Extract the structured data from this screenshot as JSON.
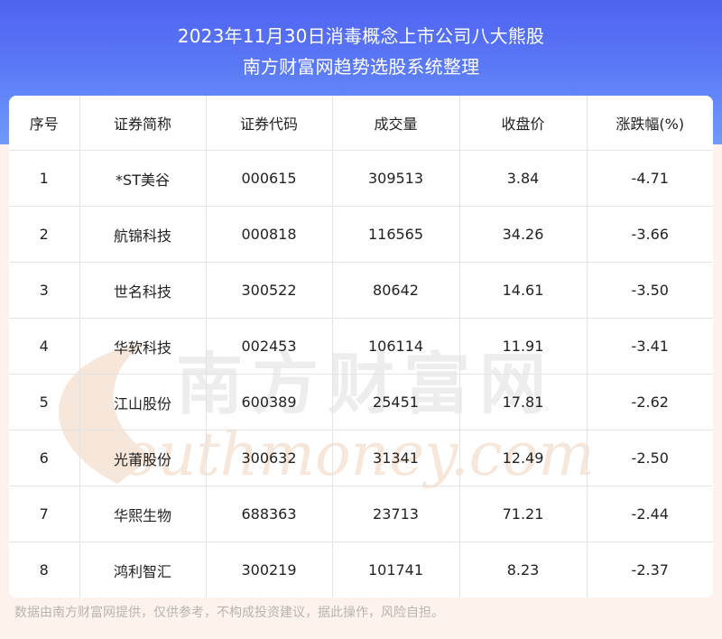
{
  "header": {
    "title_line1": "2023年11月30日消毒概念上市公司八大熊股",
    "title_line2": "南方财富网趋势选股系统整理"
  },
  "table": {
    "columns": [
      "序号",
      "证券简称",
      "证券代码",
      "成交量",
      "收盘价",
      "涨跌幅(%)"
    ],
    "rows": [
      [
        "1",
        "*ST美谷",
        "000615",
        "309513",
        "3.84",
        "-4.71"
      ],
      [
        "2",
        "航锦科技",
        "000818",
        "116565",
        "34.26",
        "-3.66"
      ],
      [
        "3",
        "世名科技",
        "300522",
        "80642",
        "14.61",
        "-3.50"
      ],
      [
        "4",
        "华软科技",
        "002453",
        "106114",
        "11.91",
        "-3.41"
      ],
      [
        "5",
        "江山股份",
        "600389",
        "25451",
        "17.81",
        "-2.62"
      ],
      [
        "6",
        "光莆股份",
        "300632",
        "31341",
        "12.49",
        "-2.50"
      ],
      [
        "7",
        "华熙生物",
        "688363",
        "23713",
        "71.21",
        "-2.44"
      ],
      [
        "8",
        "鸿利智汇",
        "300219",
        "101741",
        "8.23",
        "-2.37"
      ]
    ]
  },
  "watermark": {
    "text_cn": "南方财富网",
    "text_en": "outhmoney.com"
  },
  "footer": {
    "disclaimer": "数据由南方财富网提供，仅供参考，不构成投资建议，据此操作，风险自担。"
  },
  "colors": {
    "header_top": "#4f63f0",
    "header_bottom": "#6f9bfb",
    "page_background": "#fdf3ec",
    "watermark": "#f5e3d6"
  }
}
